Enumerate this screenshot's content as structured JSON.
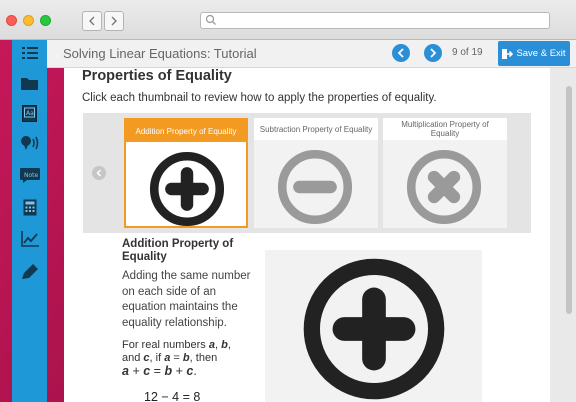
{
  "app": {
    "title": "Solving Linear Equations: Tutorial",
    "page_current": "9",
    "page_of": "of",
    "page_total": "19",
    "save_label": "Save & Exit"
  },
  "colors": {
    "accent_blue": "#2b8fd8",
    "rail_blue": "#1e98d6",
    "selected_orange": "#f29a22",
    "icon_dark": "#222222",
    "icon_gray": "#9a9a9a"
  },
  "rail": {
    "icons": [
      "list-icon",
      "folder-icon",
      "dictionary-icon",
      "audio-icon",
      "notes-icon",
      "calculator-icon",
      "graph-icon",
      "highlighter-icon"
    ]
  },
  "content": {
    "title": "Properties of Equality",
    "instructions": "Click each thumbnail to review how to apply the properties of equality.",
    "thumbnails": [
      {
        "label": "Addition Property of Equality",
        "icon": "plus-circle-icon",
        "selected": true
      },
      {
        "label": "Subtraction Property of Equality",
        "icon": "minus-circle-icon",
        "selected": false
      },
      {
        "label": "Multiplication Property of Equality",
        "icon": "times-circle-icon",
        "selected": false
      }
    ],
    "detail": {
      "heading": "Addition Property of Equality",
      "body": "Adding the same number on each side of an equation maintains the equality relationship.",
      "rule_intro": "For real numbers",
      "var_a": "a",
      "var_b": "b",
      "var_c": "c",
      "comma": ",",
      "and": "and",
      "if": "if",
      "equals": "=",
      "then": "then",
      "plus": "+",
      "period": ".",
      "example": "12 − 4 = 8"
    }
  }
}
